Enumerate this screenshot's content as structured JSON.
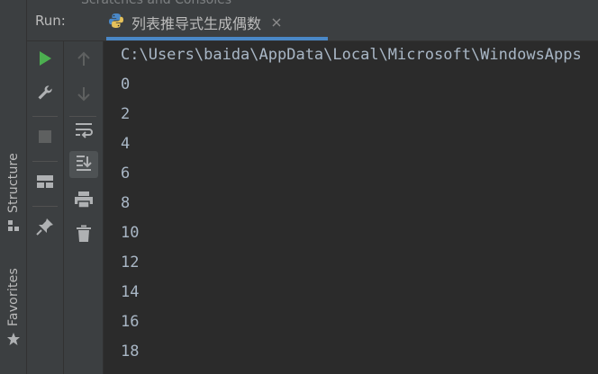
{
  "side_tabs": {
    "structure_label": "Structure",
    "favorites_label": "Favorites"
  },
  "header": {
    "run_label": "Run:",
    "tab_title": "列表推导式生成偶数",
    "ghost_text": "Scratches and Consoles"
  },
  "icons": {
    "run": "play-icon",
    "wrench": "wrench-icon",
    "stop": "stop-icon",
    "layout": "layout-icon",
    "pin": "pin-icon",
    "up": "arrow-up-icon",
    "down": "arrow-down-icon",
    "soft_wrap": "soft-wrap-icon",
    "scroll_end": "scroll-to-end-icon",
    "print": "print-icon",
    "trash": "trash-icon",
    "python": "python-icon",
    "close": "close-icon",
    "star": "star-icon"
  },
  "colors": {
    "run_green": "#4caf50",
    "tab_underline": "#4a88c7",
    "console_text": "#a9b7c6"
  },
  "console": {
    "lines": [
      "C:\\Users\\baida\\AppData\\Local\\Microsoft\\WindowsApps",
      "0",
      "2",
      "4",
      "6",
      "8",
      "10",
      "12",
      "14",
      "16",
      "18"
    ]
  }
}
